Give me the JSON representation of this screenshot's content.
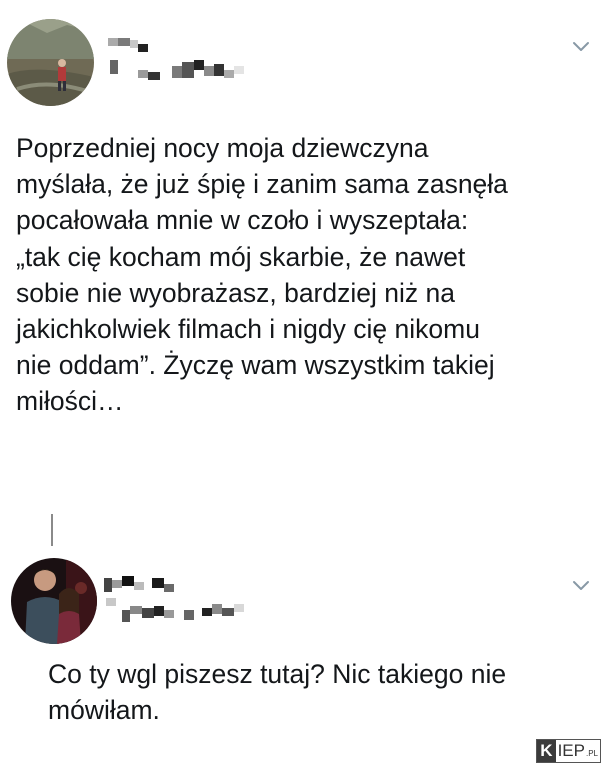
{
  "tweet": {
    "text": "Poprzedniej nocy moja dziewczyna\nmyślała, że już śpię i zanim sama zasnęła\npocałowała mnie w czoło i wyszeptała:\n„tak cię kocham mój skarbie, że nawet\nsobie nie wyobrażasz, bardziej niż na\njakichkolwiek filmach i nigdy cię nikomu\nnie oddam”. Życzę wam wszystkim takiej\nmiłości…",
    "avatar_icon": "outdoor-photo-avatar",
    "menu_icon": "chevron-down-icon"
  },
  "reply": {
    "text": "Co ty wgl piszesz tutaj? Nic takiego nie\nmówiłam.",
    "avatar_icon": "couple-photo-avatar",
    "menu_icon": "chevron-down-icon"
  },
  "watermark": {
    "k": "K",
    "rest": "IEP",
    "suffix": ".PL"
  },
  "colors": {
    "text": "#14171a",
    "chevron": "#8899a6",
    "thread_line": "#8a8a8a"
  }
}
